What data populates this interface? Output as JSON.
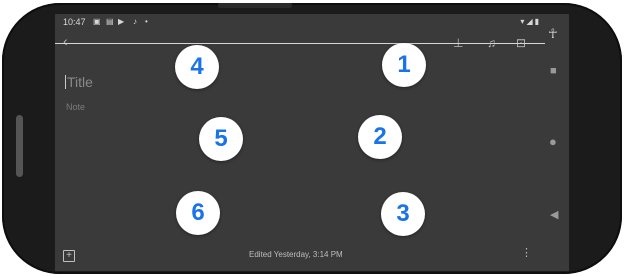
{
  "status_bar": {
    "time": "10:47",
    "left_icons": [
      "notification-icon",
      "notification-icon",
      "youtube-icon",
      "music-icon",
      "dot-icon"
    ],
    "right_icons": [
      "wifi-icon",
      "signal-icon",
      "battery-icon"
    ]
  },
  "toolbar": {
    "back_icon": "back-arrow-icon",
    "pin_icon": "pin-icon",
    "reminder_icon": "bell-icon",
    "archive_icon": "archive-icon"
  },
  "note": {
    "title_placeholder": "Title",
    "body_placeholder": "Note"
  },
  "overlay_numbers": [
    "1",
    "2",
    "3",
    "4",
    "5",
    "6"
  ],
  "bottom_bar": {
    "edited_text": "Edited Yesterday, 3:14 PM"
  },
  "colors": {
    "screen_background": "#3a3a3a",
    "number_color": "#1a73e8",
    "number_badge": "#ffffff",
    "phone_frame": "#1b1b1b"
  }
}
